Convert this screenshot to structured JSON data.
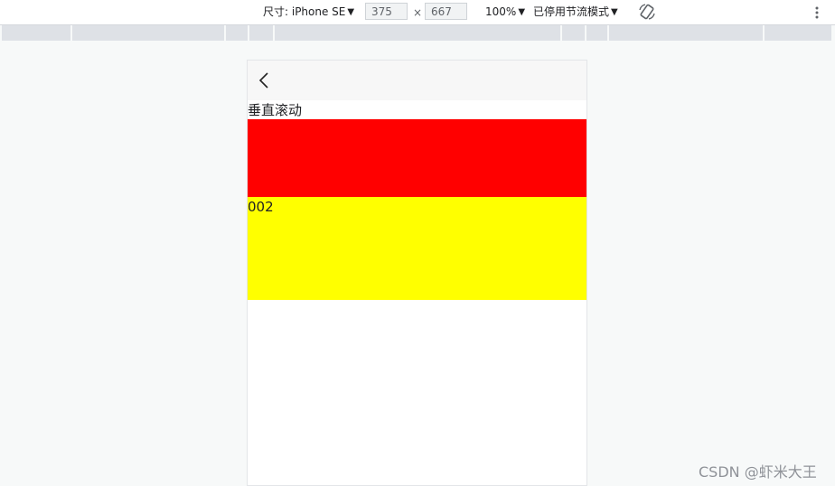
{
  "toolbar": {
    "device_label": "尺寸: iPhone SE",
    "width_value": "375",
    "separator": "×",
    "height_value": "667",
    "zoom": "100%",
    "throttling": "已停用节流模式"
  },
  "page": {
    "section_title": "垂直滚动",
    "items": [
      {
        "label": "",
        "color": "#ff0000"
      },
      {
        "label": "002",
        "color": "#ffff00"
      }
    ]
  },
  "watermark": "CSDN @虾米大王",
  "icons": {
    "back": "chevron-left-icon",
    "rotate": "rotate-icon",
    "more": "more-vertical-icon",
    "dropdown": "triangle-down-icon"
  }
}
